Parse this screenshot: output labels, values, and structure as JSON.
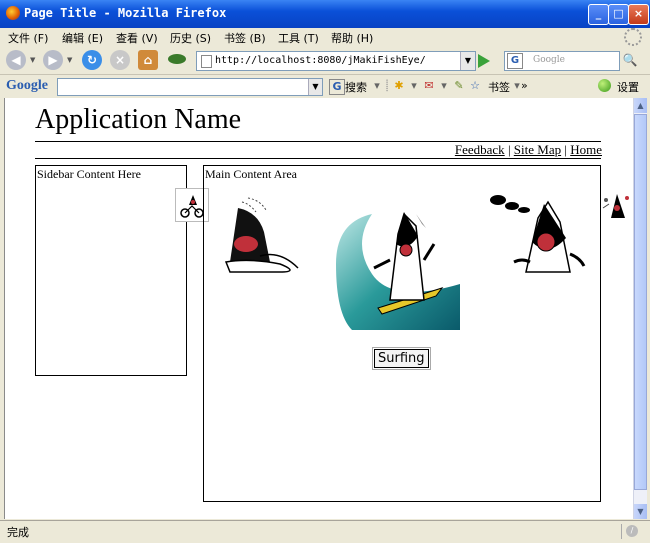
{
  "window": {
    "title": "Page Title - Mozilla Firefox",
    "min": "_",
    "max": "□",
    "close": "×"
  },
  "menu": [
    "文件 (F)",
    "编辑 (E)",
    "查看 (V)",
    "历史 (S)",
    "书签 (B)",
    "工具 (T)",
    "帮助 (H)"
  ],
  "nav": {
    "back": "◀",
    "forward": "▶",
    "reload": "↻",
    "stop": "×",
    "home": "⌂",
    "url": "http://localhost:8080/jMakiFishEye/",
    "search_engine": "G",
    "search_placeholder": "Google",
    "search_icon": "🔍"
  },
  "google_toolbar": {
    "logo": "Google",
    "search_label": "搜索",
    "bookmarks_label": "书签",
    "more": "»",
    "settings_label": "设置"
  },
  "page": {
    "app_name": "Application Name",
    "links": [
      "Feedback",
      "Site Map",
      "Home"
    ],
    "link_sep": "|",
    "sidebar_text": "Sidebar Content Here",
    "main_text": "Main Content Area",
    "fisheye_caption": "Surfing"
  },
  "status": {
    "text": "完成"
  },
  "colors": {
    "titlebar": "#0a50d8",
    "chrome": "#ece9d8",
    "accent": "#c0303a"
  }
}
